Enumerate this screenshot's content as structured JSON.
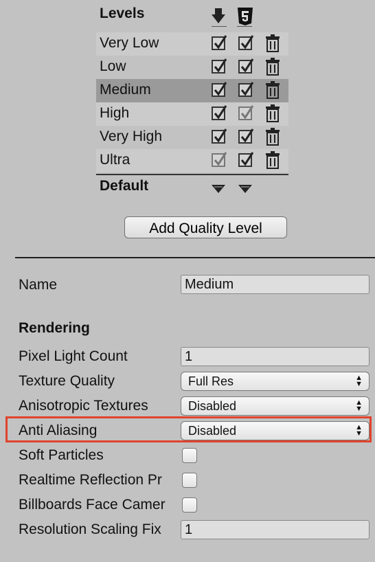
{
  "levels": {
    "title": "Levels",
    "header_icons": [
      "download-icon",
      "html5-icon"
    ],
    "rows": [
      {
        "label": "Very Low",
        "platform1": true,
        "platform2": true,
        "dim1": false,
        "dim2": false,
        "style": "alt"
      },
      {
        "label": "Low",
        "platform1": true,
        "platform2": true,
        "dim1": false,
        "dim2": false,
        "style": ""
      },
      {
        "label": "Medium",
        "platform1": true,
        "platform2": true,
        "dim1": false,
        "dim2": false,
        "style": "selected"
      },
      {
        "label": "High",
        "platform1": true,
        "platform2": true,
        "dim1": false,
        "dim2": true,
        "style": "alt"
      },
      {
        "label": "Very High",
        "platform1": true,
        "platform2": true,
        "dim1": false,
        "dim2": false,
        "style": ""
      },
      {
        "label": "Ultra",
        "platform1": true,
        "platform2": true,
        "dim1": true,
        "dim2": false,
        "style": "alt"
      }
    ],
    "default_label": "Default"
  },
  "add_button_label": "Add Quality Level",
  "name": {
    "label": "Name",
    "value": "Medium"
  },
  "rendering": {
    "section_title": "Rendering",
    "pixel_light_count": {
      "label": "Pixel Light Count",
      "value": "1"
    },
    "texture_quality": {
      "label": "Texture Quality",
      "value": "Full Res"
    },
    "anisotropic_textures": {
      "label": "Anisotropic Textures",
      "value": "Disabled"
    },
    "anti_aliasing": {
      "label": "Anti Aliasing",
      "value": "Disabled"
    },
    "soft_particles": {
      "label": "Soft Particles",
      "checked": false
    },
    "realtime_reflection_probes": {
      "label": "Realtime Reflection Pr",
      "checked": false
    },
    "billboards_face_camera": {
      "label": "Billboards Face Camer",
      "checked": false
    },
    "resolution_scaling_fix": {
      "label": "Resolution Scaling Fix",
      "value": "1"
    }
  },
  "colors": {
    "highlight": "#e0432d",
    "background": "#c2c2c2",
    "selected_row": "#9a9a9a"
  }
}
